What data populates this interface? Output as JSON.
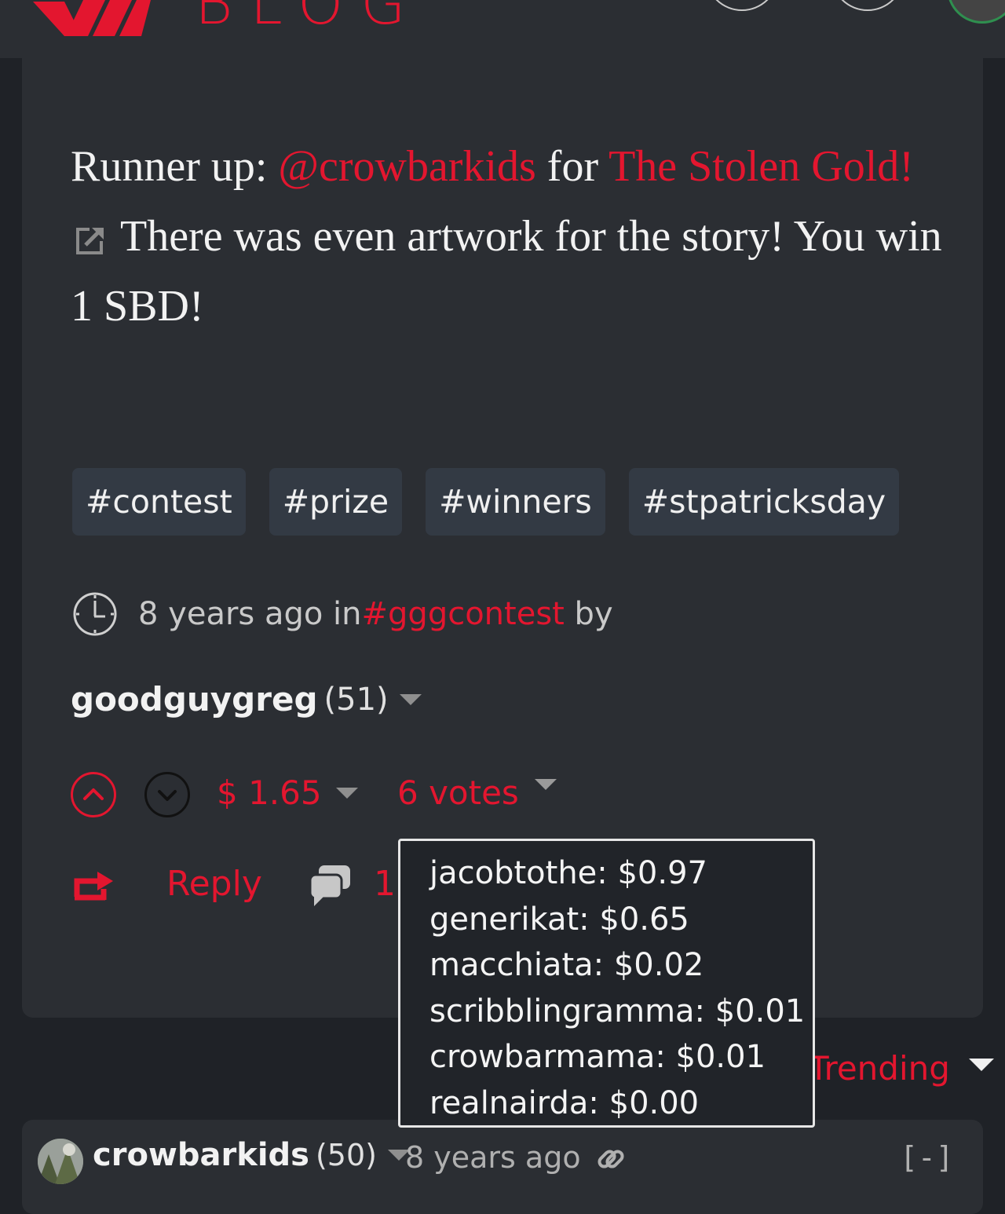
{
  "header": {
    "logo_text": "BLOG"
  },
  "post": {
    "body_parts": {
      "p1": "Runner up: ",
      "mention": "@crowbarkids",
      "p2": " for ",
      "link": "The Stolen Gold!",
      "p3": " There was even artwork for the story! You win 1 SBD!"
    },
    "tags": [
      "#contest",
      "#prize",
      "#winners",
      "#stpatricksday"
    ],
    "meta": {
      "time": "8 years ago in ",
      "category": "#gggcontest",
      "by": " by"
    },
    "author": {
      "name": "goodguygreg",
      "rep": "(51)"
    },
    "payout": "$ 1.65",
    "votes_label": "6 votes",
    "reply_label": "Reply",
    "comment_count": "1"
  },
  "voters_tooltip": [
    "jacobtothe: $0.97",
    "generikat: $0.65",
    "macchiata: $0.02",
    "scribblingramma: $0.01",
    "crowbarmama: $0.01",
    "realnairda: $0.00"
  ],
  "comments": {
    "sort_label": "Trending",
    "first": {
      "author": "crowbarkids",
      "rep": "(50)",
      "time": "8 years ago",
      "collapse": "[-]"
    }
  },
  "colors": {
    "accent": "#e3162f",
    "background": "#1f2227",
    "card": "#2b2e33",
    "tag_bg": "#333a44"
  }
}
